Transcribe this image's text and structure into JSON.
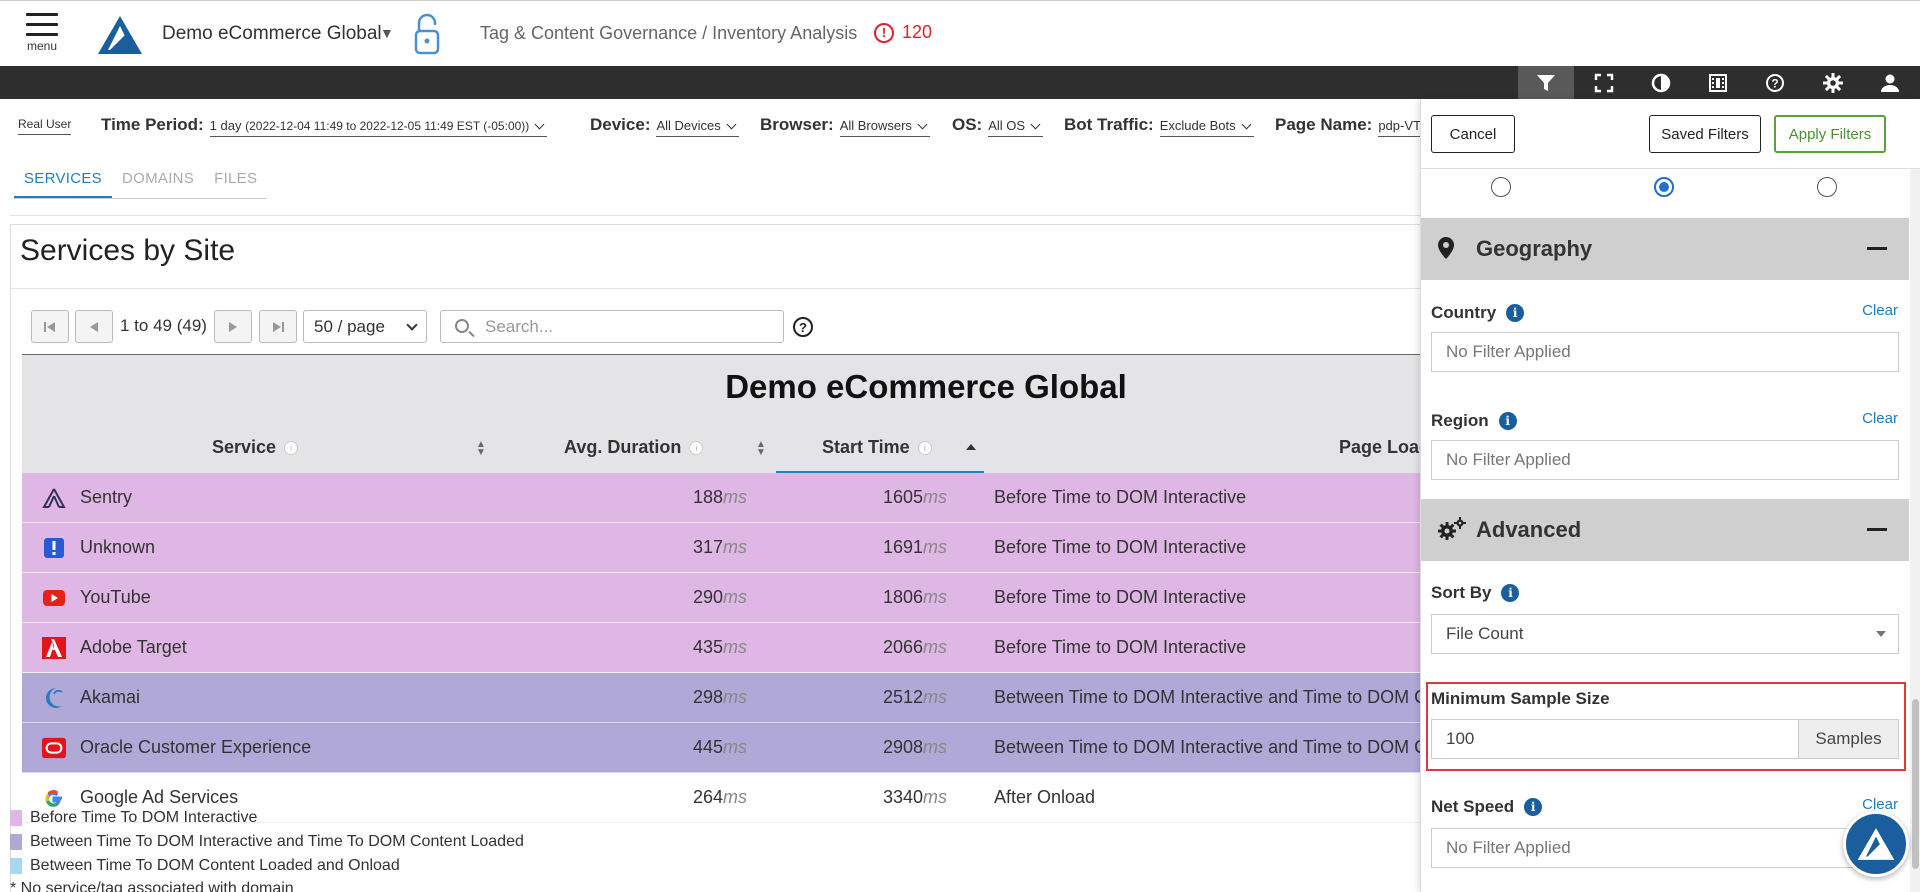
{
  "header": {
    "menu_label": "menu",
    "app_title": "Demo eCommerce Global",
    "breadcrumb": "Tag & Content Governance / Inventory Analysis",
    "alert_count": "120",
    "alert_symbol": "!"
  },
  "toolbar": {
    "icons": [
      "filter-icon",
      "fullscreen-icon",
      "contrast-icon",
      "film-icon",
      "help-icon",
      "gear-icon",
      "user-icon"
    ]
  },
  "filters": {
    "real_user": "Real User",
    "time_period_label": "Time Period:",
    "time_period_value": "1 day",
    "time_period_range": "(2022-12-04 11:49 to 2022-12-05 11:49 EST (-05:00))",
    "device_label": "Device:",
    "device_value": "All Devices",
    "browser_label": "Browser:",
    "browser_value": "All Browsers",
    "os_label": "OS:",
    "os_value": "All OS",
    "bot_label": "Bot Traffic:",
    "bot_value": "Exclude Bots",
    "page_label": "Page Name:",
    "page_value": "pdp-VT"
  },
  "tabs": [
    "SERVICES",
    "DOMAINS",
    "FILES"
  ],
  "panel": {
    "title": "Services by Site",
    "pager_text": "1 to 49 (49)",
    "per_page": "50 / page",
    "search_placeholder": "Search...",
    "help": "?"
  },
  "table": {
    "site_title": "Demo eCommerce Global",
    "columns": [
      "Service",
      "Avg. Duration",
      "Start Time",
      "Page Load"
    ],
    "unit": "ms",
    "rows": [
      {
        "service": "Sentry",
        "duration": "188",
        "start": "1605",
        "page_load": "Before Time to DOM Interactive",
        "phase": "p1"
      },
      {
        "service": "Unknown",
        "duration": "317",
        "start": "1691",
        "page_load": "Before Time to DOM Interactive",
        "phase": "p1"
      },
      {
        "service": "YouTube",
        "duration": "290",
        "start": "1806",
        "page_load": "Before Time to DOM Interactive",
        "phase": "p1"
      },
      {
        "service": "Adobe Target",
        "duration": "435",
        "start": "2066",
        "page_load": "Before Time to DOM Interactive",
        "phase": "p1"
      },
      {
        "service": "Akamai",
        "duration": "298",
        "start": "2512",
        "page_load": "Between Time to DOM Interactive and Time to DOM Co",
        "phase": "p2"
      },
      {
        "service": "Oracle Customer Experience",
        "duration": "445",
        "start": "2908",
        "page_load": "Between Time to DOM Interactive and Time to DOM Co",
        "phase": "p2"
      },
      {
        "service": "Google Ad Services",
        "duration": "264",
        "start": "3340",
        "page_load": "After Onload",
        "phase": "p3"
      }
    ]
  },
  "legend": [
    {
      "label": "Before Time To DOM Interactive",
      "color": "#dfb7e4"
    },
    {
      "label": "Between Time To DOM Interactive and Time To DOM Content Loaded",
      "color": "#b0a9d8"
    },
    {
      "label": "Between Time To DOM Content Loaded and Onload",
      "color": "#a6d8f0"
    },
    {
      "label": "* No service/tag associated with domain",
      "color": ""
    }
  ],
  "filter_panel": {
    "cancel": "Cancel",
    "saved_filters": "Saved Filters",
    "apply_filters": "Apply Filters",
    "geography": "Geography",
    "country_label": "Country",
    "region_label": "Region",
    "clear": "Clear",
    "no_filter": "No Filter Applied",
    "advanced": "Advanced",
    "sort_by_label": "Sort By",
    "sort_by_value": "File Count",
    "min_sample_label": "Minimum Sample Size",
    "min_sample_value": "100",
    "samples_addon": "Samples",
    "net_speed_label": "Net Speed",
    "radio_selected_index": 1
  },
  "colors": {
    "accent_blue": "#1c7fc5",
    "apply_green": "#5aa13c",
    "alert_red": "#d9232d",
    "highlight_red": "#d93b3b"
  }
}
